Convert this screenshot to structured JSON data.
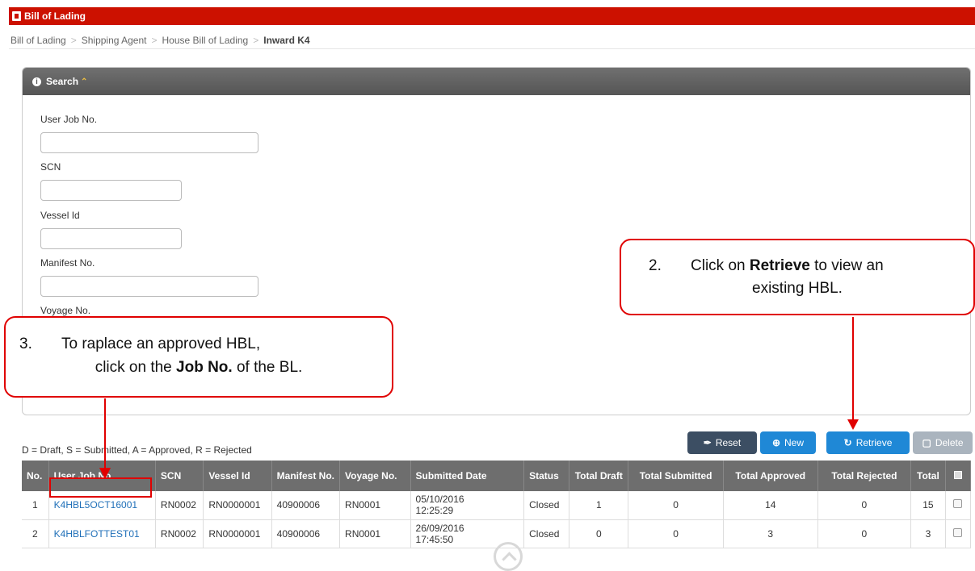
{
  "window": {
    "title": "Bill of Lading"
  },
  "breadcrumb": [
    "Bill of Lading",
    "Shipping Agent",
    "House Bill of Lading",
    "Inward K4"
  ],
  "search": {
    "title": "Search",
    "fields": [
      {
        "label": "User Job No.",
        "value": ""
      },
      {
        "label": "SCN",
        "value": ""
      },
      {
        "label": "Vessel Id",
        "value": ""
      },
      {
        "label": "Manifest No.",
        "value": ""
      },
      {
        "label": "Voyage No.",
        "value": ""
      }
    ]
  },
  "toolbar": {
    "reset": "Reset",
    "new": "New",
    "retrieve": "Retrieve",
    "delete": "Delete"
  },
  "legend": "D = Draft, S = Submitted, A = Approved, R = Rejected",
  "table": {
    "headers": [
      "No.",
      "User Job No.",
      "SCN",
      "Vessel Id",
      "Manifest No.",
      "Voyage No.",
      "Submitted Date",
      "Status",
      "Total Draft",
      "Total Submitted",
      "Total Approved",
      "Total Rejected",
      "Total"
    ],
    "rows": [
      {
        "no": "1",
        "job": "K4HBL5OCT16001",
        "scn": "RN0002",
        "vessel": "RN0000001",
        "manifest": "40900006",
        "voyage": "RN0001",
        "date": "05/10/2016",
        "time": "12:25:29",
        "status": "Closed",
        "draft": "1",
        "submitted": "0",
        "approved": "14",
        "rejected": "0",
        "total": "15"
      },
      {
        "no": "2",
        "job": "K4HBLFOTTEST01",
        "scn": "RN0002",
        "vessel": "RN0000001",
        "manifest": "40900006",
        "voyage": "RN0001",
        "date": "26/09/2016",
        "time": "17:45:50",
        "status": "Closed",
        "draft": "0",
        "submitted": "0",
        "approved": "3",
        "rejected": "0",
        "total": "3"
      }
    ]
  },
  "callouts": {
    "retrieve": {
      "num": "2.",
      "pre": "Click on ",
      "bold": "Retrieve",
      "post": " to view an",
      "line2": "existing HBL."
    },
    "job": {
      "num": "3.",
      "line1": "To raplace an approved HBL,",
      "pre": "click on the ",
      "bold": "Job No.",
      "post": " of the BL."
    }
  },
  "colors": {
    "title_bar": "#cc1100",
    "annotation": "#e00000",
    "primary_button": "#1f88d6",
    "dark_button": "#3c4e63"
  }
}
